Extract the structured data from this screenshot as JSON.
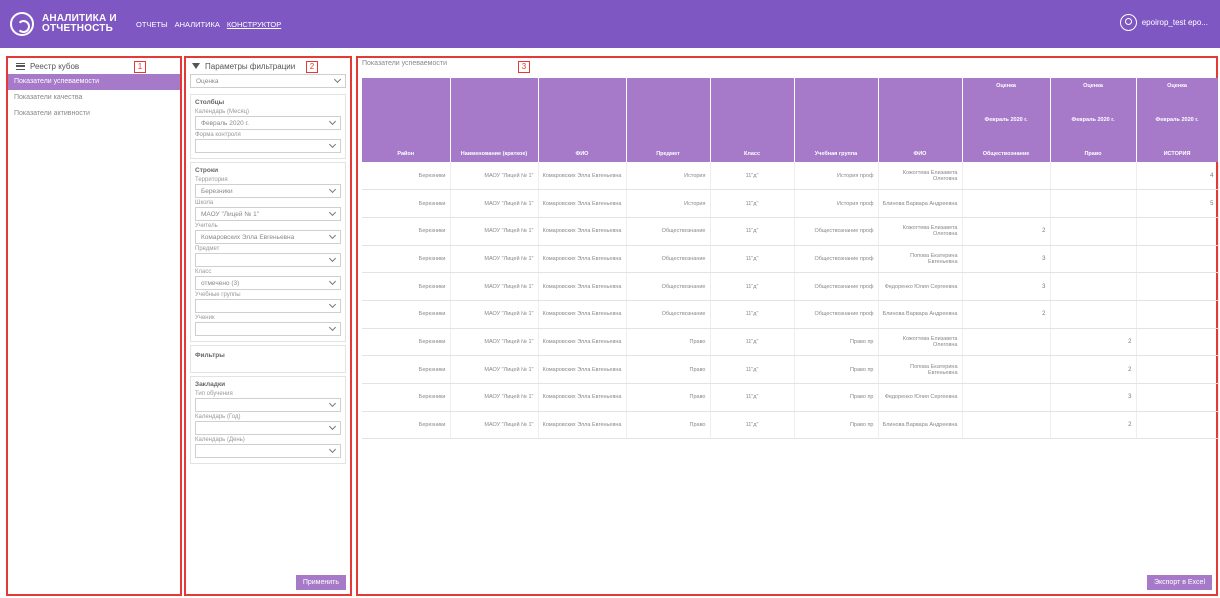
{
  "header": {
    "app_title": "АНАЛИТИКА И ОТЧЕТНОСТЬ",
    "nav": [
      "ОТЧЕТЫ",
      "АНАЛИТИКА",
      "КОНСТРУКТОР"
    ],
    "user_name": "epoirop_test epo..."
  },
  "markers": [
    "1",
    "2",
    "3"
  ],
  "cubes": {
    "title": "Реестр кубов",
    "items": [
      "Показатели успеваемости",
      "Показатели качества",
      "Показатели активности"
    ]
  },
  "filters": {
    "title": "Параметры фильтрации",
    "measure_value": "Оценка",
    "columns": {
      "title": "Столбцы",
      "calendar_label": "Календарь (Месяц)",
      "calendar_value": "Февраль 2020 г.",
      "control_label": "Форма контроля",
      "control_value": ""
    },
    "rows": {
      "title": "Строки",
      "territory_label": "Территория",
      "territory_value": "Березники",
      "school_label": "Школа",
      "school_value": "МАОУ \"Лицей № 1\"",
      "teacher_label": "Учитель",
      "teacher_value": "Комаровских Элла Евгеньевна",
      "subject_label": "Предмет",
      "subject_value": "",
      "class_label": "Класс",
      "class_value": "отмечено (3)",
      "group_label": "Учебные группы",
      "group_value": "",
      "student_label": "Ученик",
      "student_value": ""
    },
    "filters_title": "Фильтры",
    "bookmarks": {
      "title": "Закладки",
      "type_label": "Тип обучения",
      "type_value": "",
      "year_label": "Календарь (Год)",
      "year_value": "",
      "day_label": "Календарь (День)",
      "day_value": ""
    },
    "apply_label": "Применить"
  },
  "table": {
    "title": "Показатели успеваемости",
    "headers": [
      "Район",
      "Наименование (краткое)",
      "ФИО",
      "Предмет",
      "Класс",
      "Учебная группа",
      "ФИО",
      [
        "Оценка",
        "Февраль 2020 г.",
        "Обществознание"
      ],
      [
        "Оценка",
        "Февраль 2020 г.",
        "Право"
      ],
      [
        "Оценка",
        "Февраль 2020 г.",
        "ИСТОРИЯ"
      ]
    ],
    "rows": [
      [
        "Березники",
        "МАОУ \"Лицей № 1\"",
        "Комаровских Элла Евгеньевна",
        "История",
        "11\"д\"",
        "История проф",
        "Кожогтева Елизавета Олеговна",
        "",
        "",
        "4"
      ],
      [
        "Березники",
        "МАОУ \"Лицей № 1\"",
        "Комаровских Элла Евгеньевна",
        "История",
        "11\"д\"",
        "История проф",
        "Блинова Варвара Андреевна",
        "",
        "",
        "5"
      ],
      [
        "Березники",
        "МАОУ \"Лицей № 1\"",
        "Комаровских Элла Евгеньевна",
        "Обществознание",
        "11\"д\"",
        "Обществознание проф",
        "Кожогтева Елизавета Олеговна",
        "2",
        "",
        ""
      ],
      [
        "Березники",
        "МАОУ \"Лицей № 1\"",
        "Комаровских Элла Евгеньевна",
        "Обществознание",
        "11\"д\"",
        "Обществознание проф",
        "Попова Екатерина Евгеньевна",
        "3",
        "",
        ""
      ],
      [
        "Березники",
        "МАОУ \"Лицей № 1\"",
        "Комаровских Элла Евгеньевна",
        "Обществознание",
        "11\"д\"",
        "Обществознание проф",
        "Федоренко Юлия Сергеевна",
        "3",
        "",
        ""
      ],
      [
        "Березники",
        "МАОУ \"Лицей № 1\"",
        "Комаровских Элла Евгеньевна",
        "Обществознание",
        "11\"д\"",
        "Обществознание проф",
        "Блинова Варвара Андреевна",
        "2",
        "",
        ""
      ],
      [
        "Березники",
        "МАОУ \"Лицей № 1\"",
        "Комаровских Элла Евгеньевна",
        "Право",
        "11\"д\"",
        "Право пр",
        "Кожогтева Елизавета Олеговна",
        "",
        "2",
        ""
      ],
      [
        "Березники",
        "МАОУ \"Лицей № 1\"",
        "Комаровских Элла Евгеньевна",
        "Право",
        "11\"д\"",
        "Право пр",
        "Попова Екатерина Евгеньевна",
        "",
        "2",
        ""
      ],
      [
        "Березники",
        "МАОУ \"Лицей № 1\"",
        "Комаровских Элла Евгеньевна",
        "Право",
        "11\"д\"",
        "Право пр",
        "Федоренко Юлия Сергеевна",
        "",
        "3",
        ""
      ],
      [
        "Березники",
        "МАОУ \"Лицей № 1\"",
        "Комаровских Элла Евгеньевна",
        "Право",
        "11\"д\"",
        "Право пр",
        "Блинова Варвара Андреевна",
        "",
        "2",
        ""
      ]
    ],
    "export_label": "Экспорт в Excel"
  }
}
